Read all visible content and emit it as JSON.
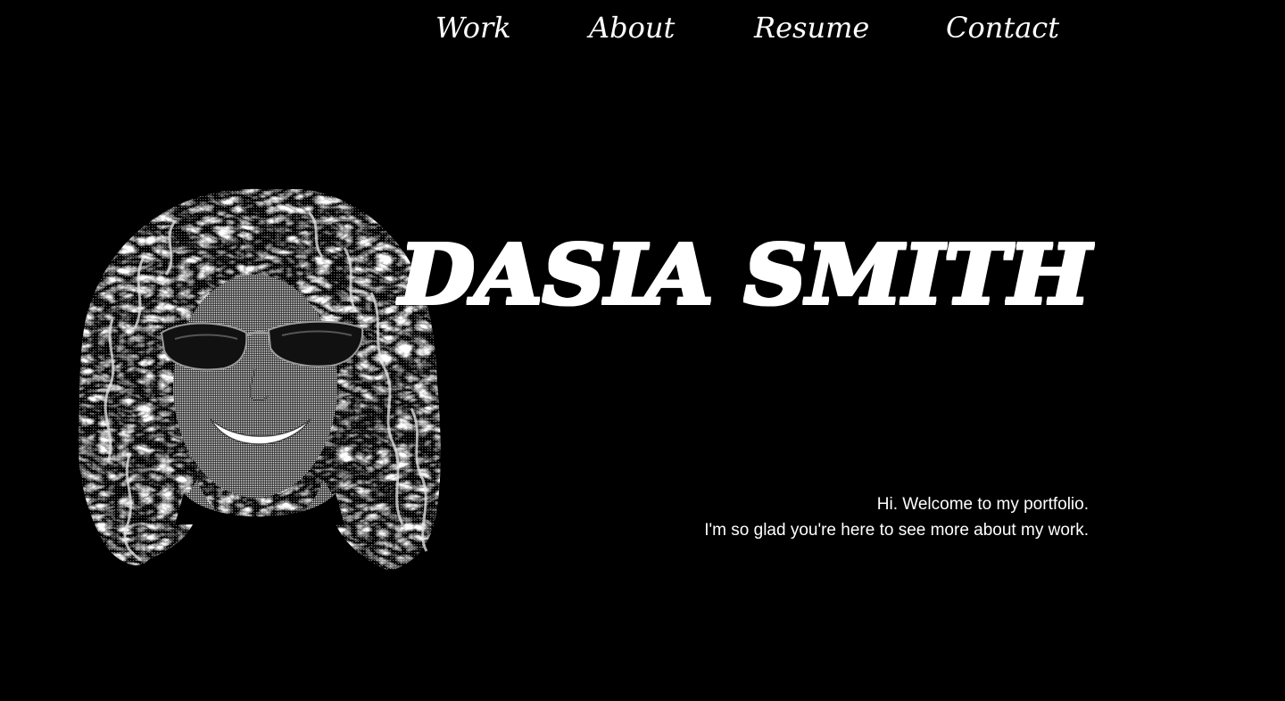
{
  "nav": {
    "items": [
      {
        "label": "Work"
      },
      {
        "label": "About"
      },
      {
        "label": "Resume"
      },
      {
        "label": "Contact"
      }
    ]
  },
  "hero": {
    "name": "DASIA SMITH",
    "portrait_icon": "dithered-portrait-photo"
  },
  "intro": {
    "line1": "Hi. Welcome to my portfolio.",
    "line2": "I'm so glad you're here to see more about my work."
  },
  "colors": {
    "background": "#000000",
    "text": "#ffffff"
  }
}
